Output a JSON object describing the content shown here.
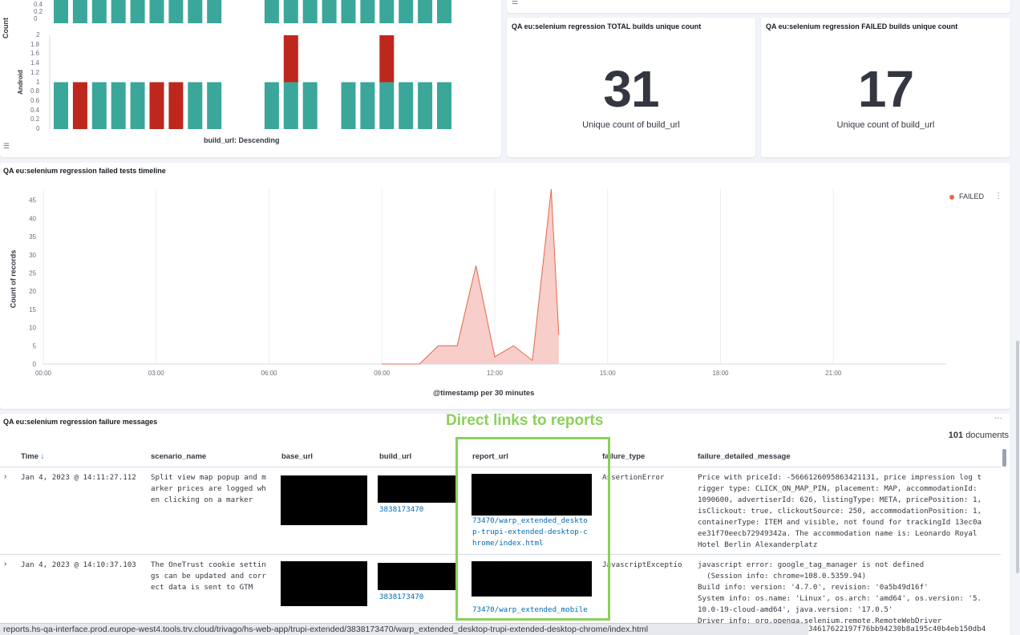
{
  "colors": {
    "green": "#3aa79a",
    "red": "#bd271e",
    "area_fill": "#f6c6c0",
    "area_line": "#e7664c",
    "annotation": "#8bd05a",
    "link": "#006bb4"
  },
  "top_chart": {
    "y_label": "Count",
    "row_label": "Android",
    "top_row_ticks": [
      "0.4",
      "0.2",
      "0"
    ],
    "android_ticks": [
      "2",
      "1.8",
      "1.6",
      "1.4",
      "1.2",
      "1",
      "0.8",
      "0.6",
      "0.4",
      "0.2",
      "0"
    ],
    "x_label": "build_url: Descending",
    "top_row_values": [
      1,
      1,
      1,
      1,
      1,
      1,
      1,
      1,
      1,
      0,
      0,
      1,
      1,
      1,
      1,
      1,
      1,
      1,
      1,
      1,
      1
    ],
    "bars": [
      {
        "total": 1,
        "failed": 0
      },
      {
        "total": 1,
        "failed": 1
      },
      {
        "total": 1,
        "failed": 0
      },
      {
        "total": 1,
        "failed": 0
      },
      {
        "total": 1,
        "failed": 0
      },
      {
        "total": 1,
        "failed": 1
      },
      {
        "total": 1,
        "failed": 1
      },
      {
        "total": 1,
        "failed": 0
      },
      {
        "total": 1,
        "failed": 0
      },
      {
        "total": 0,
        "failed": 0
      },
      {
        "total": 0,
        "failed": 0
      },
      {
        "total": 1,
        "failed": 0
      },
      {
        "total": 2,
        "failed": 1
      },
      {
        "total": 1,
        "failed": 0
      },
      {
        "total": 0,
        "failed": 0
      },
      {
        "total": 1,
        "failed": 0
      },
      {
        "total": 1,
        "failed": 0
      },
      {
        "total": 2,
        "failed": 1
      },
      {
        "total": 1,
        "failed": 0
      },
      {
        "total": 1,
        "failed": 0
      },
      {
        "total": 1,
        "failed": 0
      }
    ]
  },
  "metric_total": {
    "title": "QA eu:selenium regression TOTAL builds unique count",
    "value": "31",
    "label": "Unique count of build_url"
  },
  "metric_failed": {
    "title": "QA eu:selenium regression FAILED builds unique count",
    "value": "17",
    "label": "Unique count of build_url"
  },
  "chart_data": {
    "type": "area",
    "title": "QA eu:selenium regression failed tests timeline",
    "xlabel": "@timestamp per 30 minutes",
    "ylabel": "Count of records",
    "x_ticks": [
      "00:00",
      "03:00",
      "06:00",
      "09:00",
      "12:00",
      "15:00",
      "18:00",
      "21:00"
    ],
    "y_ticks": [
      0,
      5,
      10,
      15,
      20,
      25,
      30,
      35,
      40,
      45
    ],
    "ylim": [
      0,
      48
    ],
    "xlim": [
      "00:00",
      "24:00"
    ],
    "grid": true,
    "legend_position": "top-right",
    "series": [
      {
        "name": "FAILED",
        "x": [
          "09:00",
          "09:30",
          "10:00",
          "10:30",
          "11:00",
          "11:30",
          "12:00",
          "12:30",
          "13:00",
          "13:30",
          "14:00"
        ],
        "values": [
          0,
          0,
          0,
          5,
          5,
          27,
          2,
          5,
          1,
          48,
          8
        ]
      }
    ]
  },
  "table": {
    "title": "QA eu:selenium regression failure messages",
    "annotation": "Direct links to reports",
    "doc_count": "101",
    "doc_label": "documents",
    "columns": [
      "Time",
      "scenario_name",
      "base_url",
      "build_url",
      "report_url",
      "failure_type",
      "failure_detailed_message"
    ],
    "rows": [
      {
        "time": "Jan 4, 2023 @ 14:11:27.112",
        "scenario": "Split view map popup and m\narker prices are logged wh\nen clicking on a marker",
        "build_url": "3838173470",
        "report_url": "73470/warp_extended_deskto\np-trupi-extended-desktop-c\nhrome/index.html",
        "failure_type": "AssertionError",
        "message": "Price with priceId: -5666126095863421131, price impression log t\nrigger type: CLICK_ON_MAP_PIN, placement: MAP, accommodationId:\n1090600, advertiserId: 626, listingType: META, pricePosition: 1,\nisClickout: true, clickoutSource: 250, accommodationPosition: 1,\ncontainerType: ITEM and visible, not found for trackingId 13ec0a\nee31f70eecb72949342a. The accommodation name is: Leonardo Royal\nHotel Berlin Alexanderplatz"
      },
      {
        "time": "Jan 4, 2023 @ 14:10:37.103",
        "scenario": "The OneTrust cookie settin\ngs can be updated and corr\nect data is sent to GTM",
        "build_url": "3838173470",
        "report_url": "73470/warp_extended_mobile",
        "failure_type": "JavascriptExceptio",
        "message": "javascript error: google_tag_manager is not defined\n  (Session info: chrome=108.0.5359.94)\nBuild info: version: '4.7.0', revision: '0a5b49d16f'\nSystem info: os.name: 'Linux', os.arch: 'amd64', os.version: '5.\n10.0-19-cloud-amd64', java.version: '17.0.5'\nDriver info: org.openqa.selenium.remote.RemoteWebDriver"
      }
    ]
  },
  "status_bar": {
    "url": "reports.hs-qa-interface.prod.europe-west4.tools.trv.cloud/trivago/hs-web-app/trupi-extended/3838173470/warp_extended_desktop-trupi-extended-desktop-chrome/index.html",
    "overflow_text": "34617622197f76bb94230b8a195c40b4eb150db4"
  }
}
